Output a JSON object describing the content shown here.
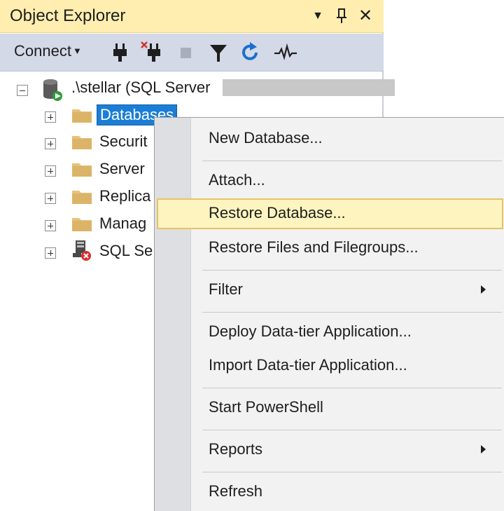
{
  "panel": {
    "title": "Object Explorer",
    "controls": {
      "dropdown_icon": "dropdown-arrow-icon",
      "pin_icon": "pin-icon",
      "close_icon": "close-icon"
    }
  },
  "toolbar": {
    "connect_label": "Connect",
    "tools": [
      "connect-plug-icon",
      "disconnect-plug-icon",
      "stop-icon",
      "filter-icon",
      "refresh-icon",
      "activity-monitor-icon"
    ]
  },
  "tree": {
    "server_label": ".\\stellar (SQL Server",
    "nodes": [
      {
        "label": "Databases",
        "selected": true
      },
      {
        "label": "Securit"
      },
      {
        "label": "Server"
      },
      {
        "label": "Replica"
      },
      {
        "label": "Manag"
      },
      {
        "label": "SQL Se"
      }
    ]
  },
  "context_menu": {
    "items": [
      {
        "label": "New Database..."
      },
      {
        "label": "Attach..."
      },
      {
        "label": "Restore Database...",
        "highlighted": true
      },
      {
        "label": "Restore Files and Filegroups..."
      },
      {
        "label": "Filter",
        "submenu": true
      },
      {
        "label": "Deploy Data-tier Application..."
      },
      {
        "label": "Import Data-tier Application..."
      },
      {
        "label": "Start PowerShell"
      },
      {
        "label": "Reports",
        "submenu": true
      },
      {
        "label": "Refresh"
      }
    ]
  },
  "colors": {
    "title_bar": "#ffeeb0",
    "toolbar": "#d3d9e6",
    "selection": "#1b7ed6",
    "menu_highlight": "#fdf4bf",
    "menu_highlight_border": "#e5c365",
    "refresh_blue": "#1a6fd0"
  }
}
